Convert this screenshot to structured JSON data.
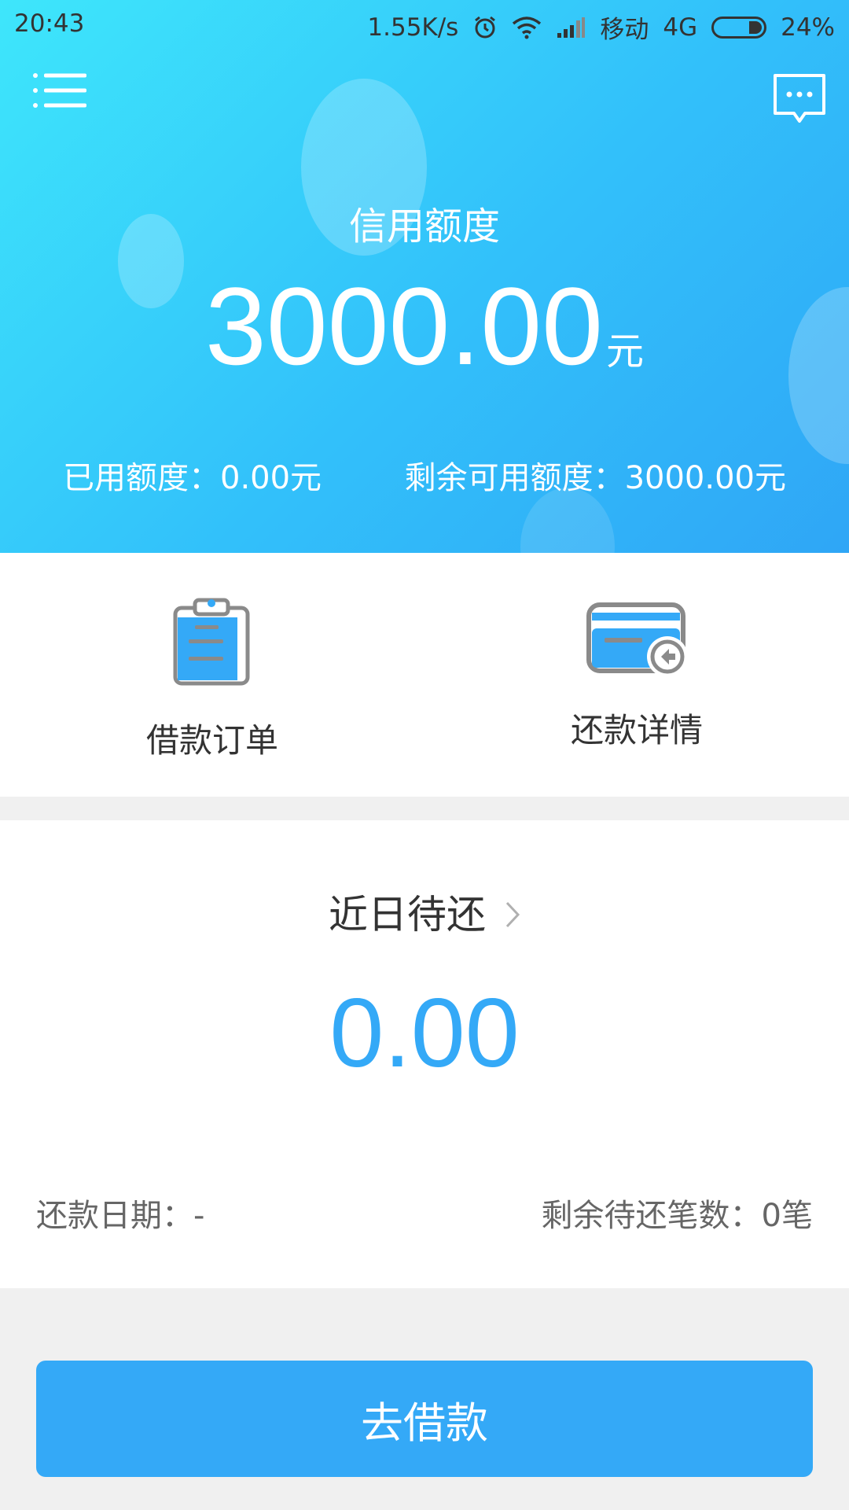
{
  "status_bar": {
    "time": "20:43",
    "network_speed": "1.55K/s",
    "carrier": "移动",
    "network_type": "4G",
    "battery": "24%"
  },
  "header": {
    "credit_label": "信用额度",
    "credit_amount": "3000.00",
    "credit_unit": "元",
    "used_credit": "已用额度：0.00元",
    "remaining_credit": "剩余可用额度：3000.00元"
  },
  "actions": {
    "loan_orders": "借款订单",
    "repayment_details": "还款详情"
  },
  "due": {
    "title": "近日待还",
    "amount": "0.00",
    "repayment_date": "还款日期：-",
    "remaining_count": "剩余待还笔数：0笔"
  },
  "borrow_button": "去借款",
  "colors": {
    "accent": "#34a9f7",
    "header_gradient_start": "#3ee6fb",
    "header_gradient_end": "#2fa6f6",
    "icon_gray": "#8a8a8a"
  },
  "icons": {
    "menu": "menu-icon",
    "message": "message-icon",
    "clipboard": "clipboard-icon",
    "card_return": "card-return-icon",
    "chevron": "chevron-right-icon"
  }
}
